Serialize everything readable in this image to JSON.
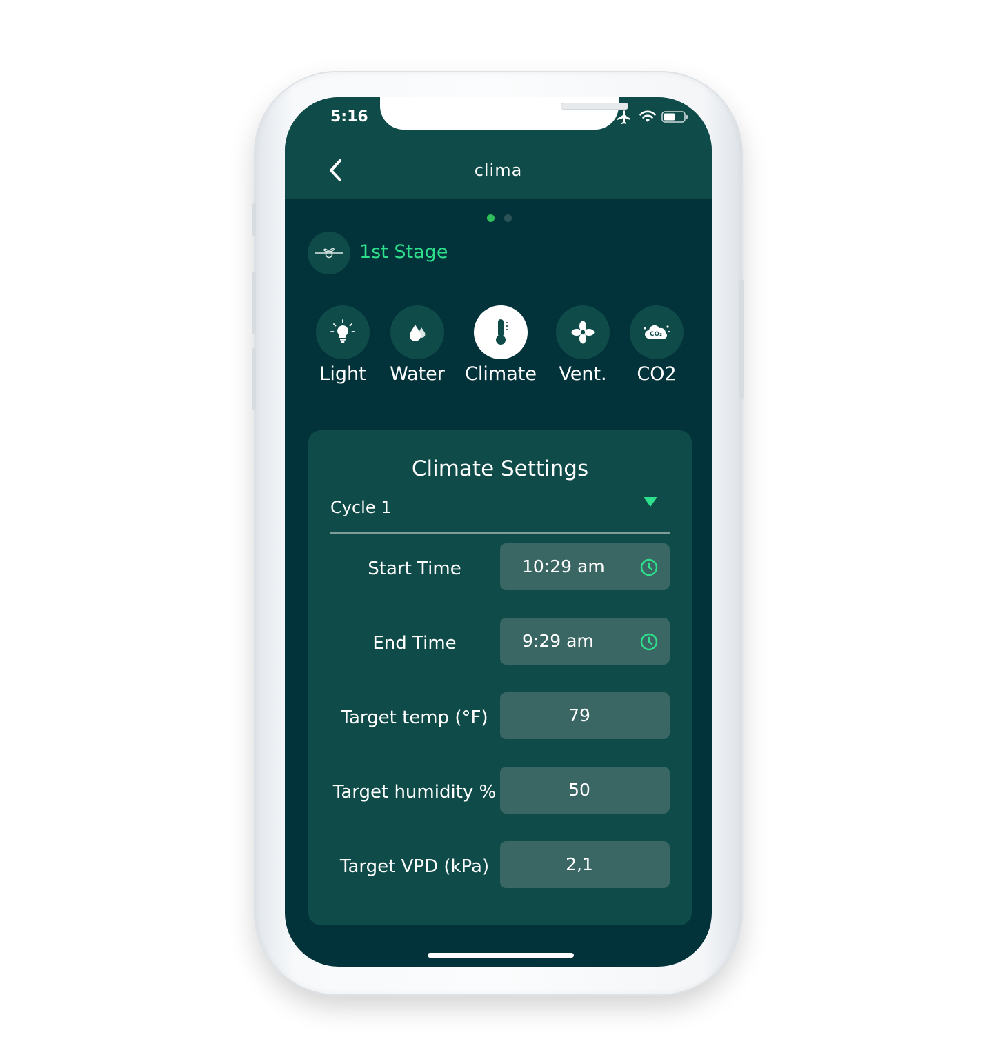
{
  "status_bar": {
    "time": "5:16"
  },
  "header": {
    "title": "clima"
  },
  "pager": {
    "count": 2,
    "active_index": 0
  },
  "stage": {
    "label": "1st Stage"
  },
  "categories": [
    {
      "label": "Light",
      "icon": "lightbulb-icon",
      "active": false
    },
    {
      "label": "Water",
      "icon": "water-drop-icon",
      "active": false
    },
    {
      "label": "Climate",
      "icon": "thermometer-icon",
      "active": true
    },
    {
      "label": "Vent.",
      "icon": "fan-icon",
      "active": false
    },
    {
      "label": "CO2",
      "icon": "co2-cloud-icon",
      "active": false
    }
  ],
  "settings": {
    "title": "Climate Settings",
    "cycle": "Cycle 1",
    "rows": [
      {
        "label": "Start Time",
        "value": "10:29 am",
        "icon": "clock-icon"
      },
      {
        "label": "End Time",
        "value": "9:29 am",
        "icon": "clock-icon"
      },
      {
        "label": "Target temp (°F)",
        "value": "79"
      },
      {
        "label": "Target humidity %",
        "value": "50"
      },
      {
        "label": "Target VPD (kPa)",
        "value": "2,1"
      }
    ]
  },
  "colors": {
    "background": "#02323a",
    "header": "#0f4b48",
    "accent": "#2ee08c",
    "field": "#3a6664"
  }
}
